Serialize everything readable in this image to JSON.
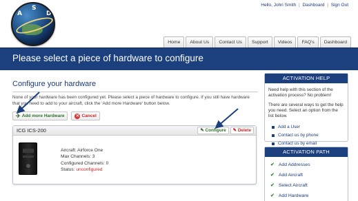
{
  "header": {
    "logo_letters": [
      "A",
      "S",
      "D"
    ],
    "top_links": {
      "greeting": "Hello, John Smith",
      "dashboard": "Dashboard",
      "sign_out": "Sign Out",
      "separator": "|"
    },
    "nav_tabs": [
      "Home",
      "About Us",
      "Contact Us",
      "Support",
      "Videos",
      "FAQ's",
      "Dashboard"
    ]
  },
  "page_title": "Please select a piece of hardware to configure",
  "main": {
    "heading": "Configure your hardware",
    "intro": "None of your hardware has been configured yet. Please select a piece of hardware to configure. If you still have hardware that you need to add to your aircraft, click the 'Add more Hardware' button below.",
    "add_button": "Add more Hardware",
    "cancel_button": "Cancel",
    "hardware": {
      "name": "ICG ICS-200",
      "configure_label": "Configure",
      "delete_label": "Delete",
      "aircraft": "Aircraft: Airforce One",
      "max_channels": "Max Channels: 3",
      "configured_channels": "Configured Channels: 0",
      "status_label": "Status:",
      "status_value": "unconfigured"
    }
  },
  "sidebar": {
    "help": {
      "title": "ACTIVATION HELP",
      "text1": "Need help with this section of the activation process? No problem!",
      "text2": "There are several ways to get the help you need. Select an option from the list below.",
      "items": [
        "Add a User",
        "Contact us by phone",
        "Contact us by email"
      ]
    },
    "path": {
      "title": "ACTIVATION PATH",
      "items": [
        "Add Addresses",
        "Add Aircraft",
        "Select Aircraft",
        "Add Hardware"
      ]
    }
  },
  "colors": {
    "brand_blue": "#1c3f7e",
    "link_blue": "#1a3a7a",
    "status_red": "#cc2222",
    "check_green": "#2e8b2e"
  },
  "icons": [
    "globe-logo",
    "airplane-icon",
    "close-circle-icon",
    "wrench-icon",
    "delete-icon",
    "bullet-square-icon",
    "checkmark-icon",
    "annotation-arrow"
  ]
}
